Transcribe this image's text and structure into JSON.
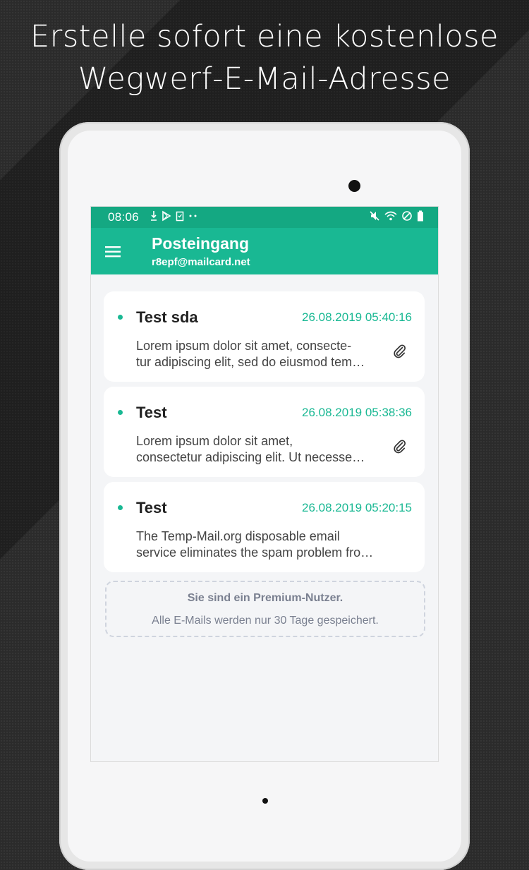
{
  "headline": {
    "line1": "Erstelle sofort eine kostenlose",
    "line2": "Wegwerf-E-Mail-Adresse"
  },
  "status_bar": {
    "time": "08:06",
    "left_icons": [
      "download-icon",
      "play-store-icon",
      "clipboard-icon",
      "more-dots-icon"
    ],
    "right_icons": [
      "mute-icon",
      "wifi-icon",
      "no-signal-icon",
      "battery-icon"
    ]
  },
  "app_bar": {
    "title": "Posteingang",
    "email": "r8epf@mailcard.net",
    "menu_icon": "hamburger-menu-icon"
  },
  "emails": [
    {
      "subject": "Test sda",
      "date": "26.08.2019 05:40:16",
      "preview_line1": "Lorem ipsum dolor sit amet, consecte-",
      "preview_line2": "tur adipiscing elit, sed do eiusmod tem…",
      "has_attachment": true,
      "unread": true
    },
    {
      "subject": "Test",
      "date": "26.08.2019 05:38:36",
      "preview_line1": "Lorem ipsum dolor sit amet,",
      "preview_line2": "consectetur adipiscing elit. Ut necesse…",
      "has_attachment": true,
      "unread": true
    },
    {
      "subject": "Test",
      "date": "26.08.2019 05:20:15",
      "preview_line1": "The Temp-Mail.org disposable email",
      "preview_line2": "service eliminates the spam problem fro…",
      "has_attachment": false,
      "unread": true
    }
  ],
  "premium": {
    "line1": "Sie sind ein Premium-Nutzer.",
    "line2": "Alle E-Mails werden nur 30 Tage gespeichert."
  },
  "colors": {
    "accent": "#19b893",
    "status_bar": "#14a882",
    "background": "#2b2b2b"
  }
}
